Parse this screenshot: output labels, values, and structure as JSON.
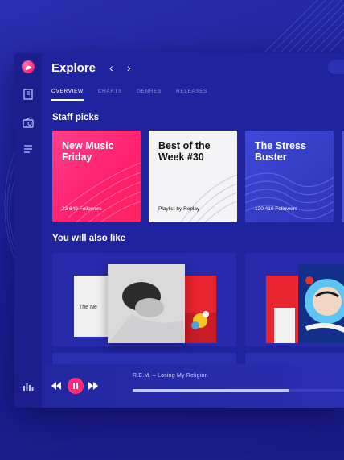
{
  "app": {
    "title": "Explore"
  },
  "nav": {
    "back": "‹",
    "forward": "›"
  },
  "tabs": [
    {
      "label": "OVERVIEW",
      "active": true
    },
    {
      "label": "CHARTS",
      "active": false
    },
    {
      "label": "GENRES",
      "active": false
    },
    {
      "label": "RELEASES",
      "active": false
    }
  ],
  "staff_picks": {
    "heading": "Staff picks",
    "cards": [
      {
        "title": "New Music Friday",
        "subtitle": "23 649 Followers"
      },
      {
        "title": "Best of the Week #30",
        "subtitle": "Playlist by Replay"
      },
      {
        "title": "The Stress Buster",
        "subtitle": "120 410 Followers"
      }
    ]
  },
  "recommendations": {
    "heading": "You will also like",
    "album_text": "The Ne"
  },
  "player": {
    "track": "R.E.M. – Losing My Religion",
    "progress": 0.74
  },
  "colors": {
    "background": "#1d1f96",
    "accent": "#ff2d7a",
    "card_pink": "#ff2f7a",
    "card_blue": "#3a43d0"
  },
  "icons": {
    "logo": "app-logo-icon",
    "library": "library-icon",
    "radio": "radio-icon",
    "queue": "queue-icon",
    "equalizer": "equalizer-icon"
  }
}
